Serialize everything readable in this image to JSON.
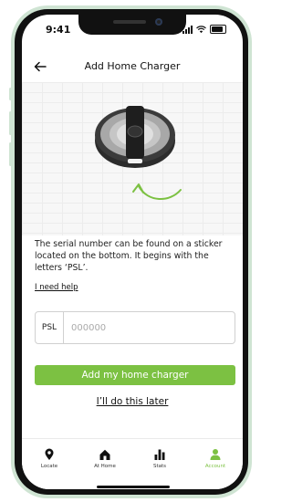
{
  "status_bar": {
    "time": "9:41"
  },
  "header": {
    "title": "Add Home Charger"
  },
  "description": "The serial number can be found on a sticker located on the bottom. It begins with the letters ‘PSL’.",
  "help_link": "I need help",
  "serial": {
    "prefix": "PSL",
    "placeholder": "000000",
    "value": ""
  },
  "primary_button": "Add my home charger",
  "secondary_link": "I’ll do this later",
  "tabs": [
    {
      "label": "Locate",
      "icon": "location-pin-icon"
    },
    {
      "label": "At Home",
      "icon": "home-icon"
    },
    {
      "label": "Stats",
      "icon": "bar-chart-icon"
    },
    {
      "label": "Account",
      "icon": "person-icon",
      "active": true
    }
  ],
  "colors": {
    "accent": "#7cc142",
    "text": "#111111",
    "phone_frame": "#cfe4d3"
  }
}
